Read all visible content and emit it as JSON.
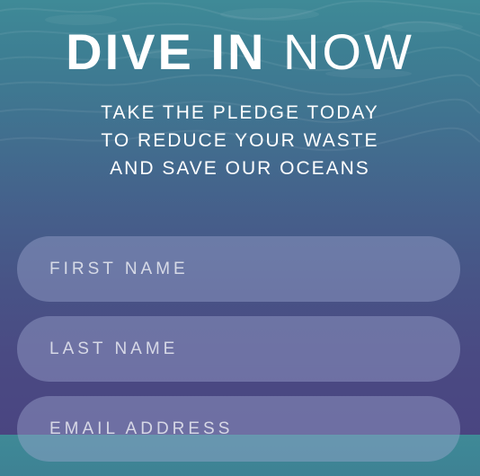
{
  "hero": {
    "headline_bold": "DIVE IN",
    "headline_light": "NOW",
    "subhead_lines": [
      "TAKE THE PLEDGE TODAY",
      "TO REDUCE YOUR WASTE",
      "AND SAVE OUR OCEANS"
    ]
  },
  "form": {
    "first_name": {
      "value": "",
      "placeholder": "FIRST NAME"
    },
    "last_name": {
      "value": "",
      "placeholder": "LAST NAME"
    },
    "email": {
      "value": "",
      "placeholder": "EMAIL ADDRESS"
    }
  },
  "colors": {
    "background_top": "#3f8a97",
    "background_bottom": "#4a4581",
    "text": "#ffffff",
    "field_fill": "#a0aad2"
  }
}
